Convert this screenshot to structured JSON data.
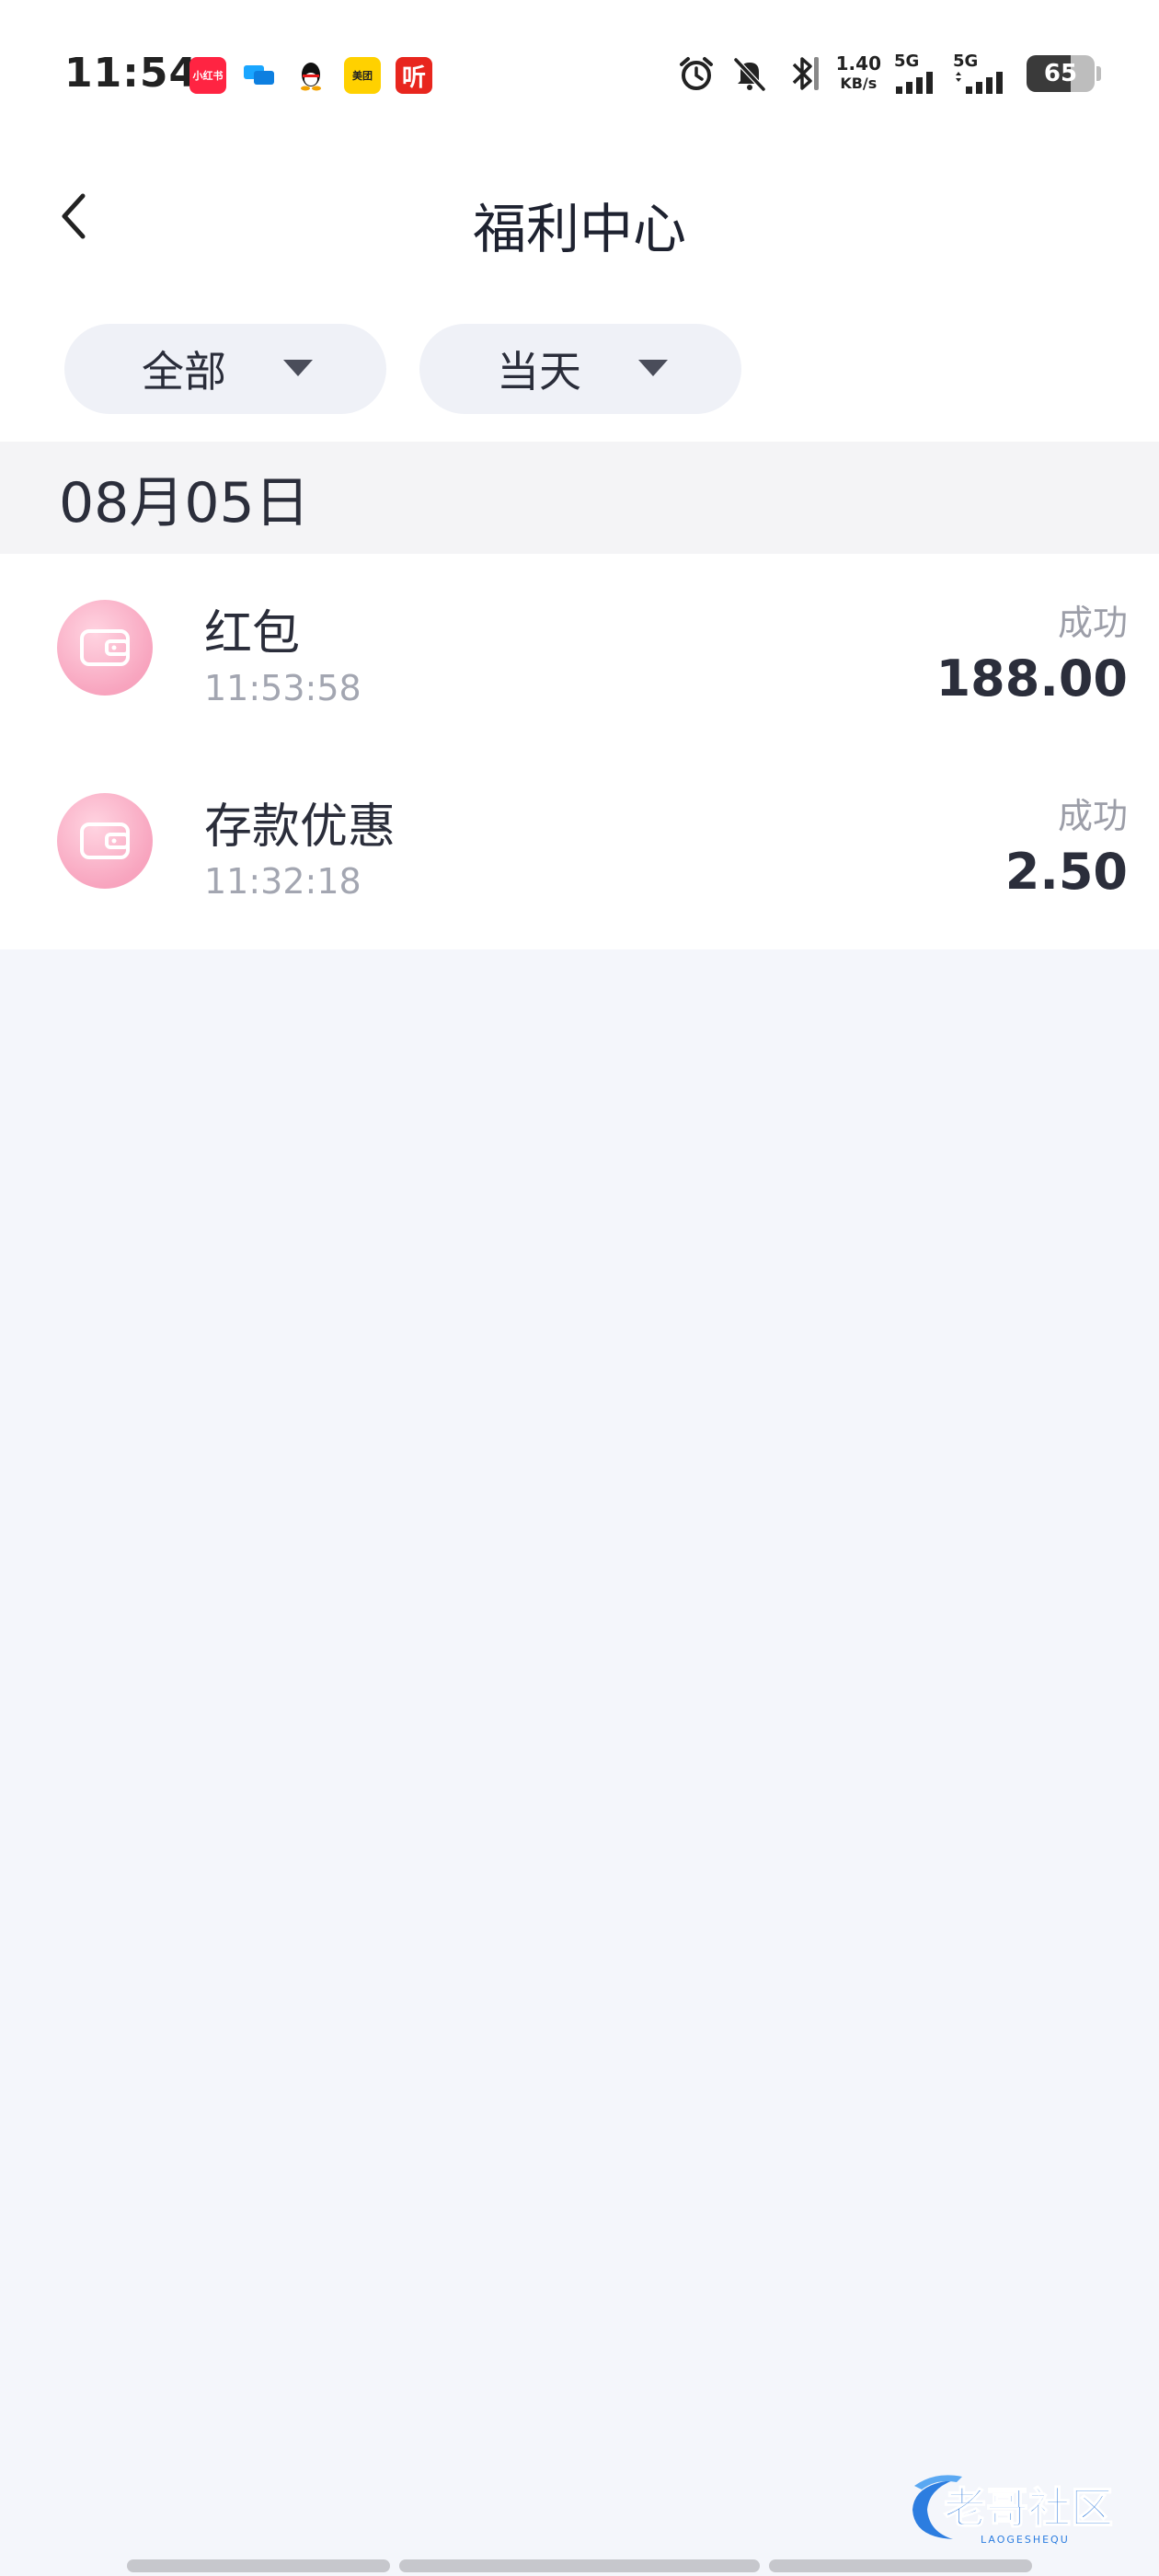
{
  "status_bar": {
    "time": "11:54",
    "notification_apps": [
      {
        "icon": "xiaohongshu-icon",
        "text": "小红书"
      },
      {
        "icon": "messages-icon",
        "text": ""
      },
      {
        "icon": "qq-icon",
        "text": ""
      },
      {
        "icon": "meituan-icon",
        "text": "美团"
      },
      {
        "icon": "ting-icon",
        "text": "听"
      }
    ],
    "net_speed_value": "1.40",
    "net_speed_unit": "KB/s",
    "signal_1_label": "5G",
    "signal_2_label": "5G",
    "battery_level": "65"
  },
  "header": {
    "title": "福利中心"
  },
  "filters": {
    "type_label": "全部",
    "range_label": "当天"
  },
  "date_group": {
    "date": "08月05日",
    "records": [
      {
        "name": "红包",
        "time": "11:53:58",
        "status": "成功",
        "amount": "188.00"
      },
      {
        "name": "存款优惠",
        "time": "11:32:18",
        "status": "成功",
        "amount": "2.50"
      }
    ]
  },
  "watermark": {
    "text": "老哥社区",
    "subtext": "LAOGESHEQU"
  },
  "colors": {
    "background": "#f4f6fb",
    "wallet_icon_pink": "#f8a5bf",
    "text_primary": "#2b2e3b",
    "text_secondary": "#a3a6b1"
  }
}
